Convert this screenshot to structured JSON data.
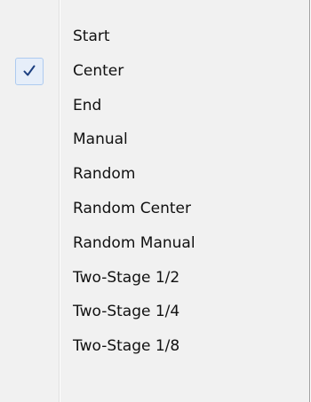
{
  "menu": {
    "items": [
      {
        "label": "Start",
        "checked": false
      },
      {
        "label": "Center",
        "checked": true
      },
      {
        "label": "End",
        "checked": false
      },
      {
        "label": "Manual",
        "checked": false
      },
      {
        "label": "Random",
        "checked": false
      },
      {
        "label": "Random Center",
        "checked": false
      },
      {
        "label": "Random Manual",
        "checked": false
      },
      {
        "label": "Two-Stage 1/2",
        "checked": false
      },
      {
        "label": "Two-Stage 1/4",
        "checked": false
      },
      {
        "label": "Two-Stage 1/8",
        "checked": false
      }
    ]
  },
  "colors": {
    "menu_background": "#f1f1f1",
    "check_highlight": "#e6eef9",
    "check_border": "#aecbf0",
    "check_mark": "#1c3f80"
  },
  "icons": {
    "check": "checkmark-icon"
  }
}
